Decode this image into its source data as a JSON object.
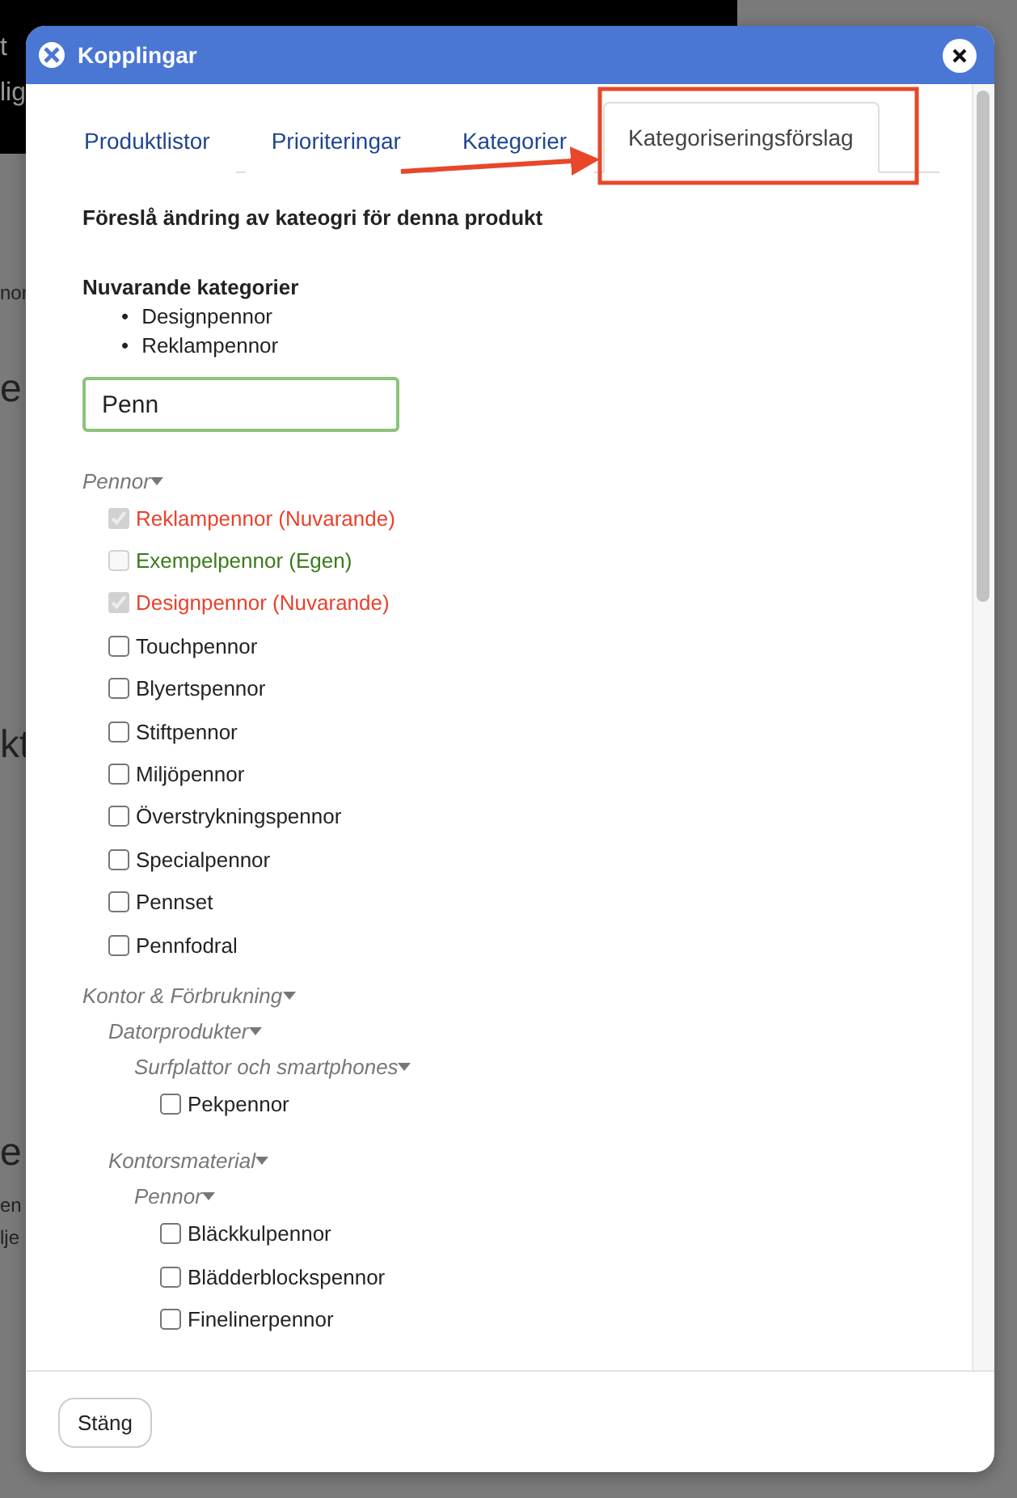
{
  "background": {
    "fragments": [
      "t",
      "lig",
      "nor",
      "e",
      "kt",
      "e",
      "en",
      "lje"
    ]
  },
  "window": {
    "title": "Kopplingar"
  },
  "tabs": [
    {
      "label": "Produktlistor",
      "selected": false
    },
    {
      "label": "Prioriteringar",
      "selected": false
    },
    {
      "label": "Kategorier",
      "selected": false
    },
    {
      "label": "Kategoriseringsförslag",
      "selected": true
    }
  ],
  "heading": "Föreslå ändring av kateogri för denna produkt",
  "current": {
    "title": "Nuvarande kategorier",
    "items": [
      {
        "bullet": "•",
        "text": "Designpennor"
      },
      {
        "bullet": "•",
        "text": "Reklampennor"
      }
    ]
  },
  "search": {
    "value": "Penn"
  },
  "tree": [
    {
      "kind": "group",
      "label": "Pennor",
      "expanded": true,
      "children": [
        {
          "kind": "option",
          "label": "Reklampennor (Nuvarande)",
          "checked": true,
          "disabled": true,
          "color": "#e8412c"
        },
        {
          "kind": "option",
          "label": "Exempelpennor (Egen)",
          "checked": false,
          "disabled": true,
          "color": "#3a7a1a"
        },
        {
          "kind": "option",
          "label": "Designpennor (Nuvarande)",
          "checked": true,
          "disabled": true,
          "color": "#e8412c"
        },
        {
          "kind": "option",
          "label": "Touchpennor",
          "checked": false,
          "disabled": false
        },
        {
          "kind": "option",
          "label": "Blyertspennor",
          "checked": false,
          "disabled": false
        },
        {
          "kind": "option",
          "label": "Stiftpennor",
          "checked": false,
          "disabled": false
        },
        {
          "kind": "option",
          "label": "Miljöpennor",
          "checked": false,
          "disabled": false
        },
        {
          "kind": "option",
          "label": "Överstrykningspennor",
          "checked": false,
          "disabled": false
        },
        {
          "kind": "option",
          "label": "Specialpennor",
          "checked": false,
          "disabled": false
        },
        {
          "kind": "option",
          "label": "Pennset",
          "checked": false,
          "disabled": false
        },
        {
          "kind": "option",
          "label": "Pennfodral",
          "checked": false,
          "disabled": false
        }
      ]
    },
    {
      "kind": "group",
      "label": "Kontor & Förbrukning",
      "expanded": true,
      "children": [
        {
          "kind": "group",
          "label": "Datorprodukter",
          "expanded": true,
          "children": [
            {
              "kind": "group",
              "label": "Surfplattor och smartphones",
              "expanded": true,
              "children": [
                {
                  "kind": "option",
                  "label": "Pekpennor",
                  "checked": false,
                  "disabled": false
                }
              ]
            }
          ]
        },
        {
          "kind": "group",
          "label": "Kontorsmaterial",
          "expanded": true,
          "children": [
            {
              "kind": "group",
              "label": "Pennor",
              "expanded": true,
              "children": [
                {
                  "kind": "option",
                  "label": "Bläckkulpennor",
                  "checked": false,
                  "disabled": false
                },
                {
                  "kind": "option",
                  "label": "Blädderblockspennor",
                  "checked": false,
                  "disabled": false
                },
                {
                  "kind": "option",
                  "label": "Finelinerpennor",
                  "checked": false,
                  "disabled": false
                }
              ]
            }
          ]
        }
      ]
    }
  ],
  "footer": {
    "close_button": "Stäng"
  }
}
